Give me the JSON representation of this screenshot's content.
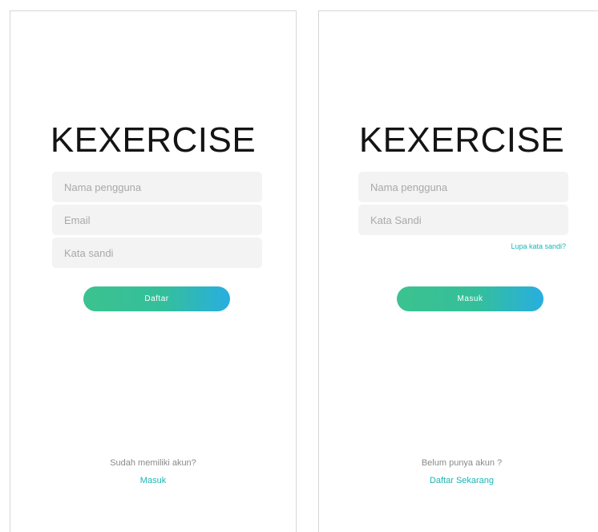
{
  "register_screen": {
    "logo": "KEXERCISE",
    "username_placeholder": "Nama pengguna",
    "email_placeholder": "Email",
    "password_placeholder": "Kata sandi",
    "submit_label": "Daftar",
    "footer_question": "Sudah memiliki akun?",
    "footer_link": "Masuk"
  },
  "login_screen": {
    "logo": "KEXERCISE",
    "username_placeholder": "Nama pengguna",
    "password_placeholder": "Kata Sandi",
    "forgot_label": "Lupa kata sandi?",
    "submit_label": "Masuk",
    "footer_question": "Belum punya akun ?",
    "footer_link": "Daftar Sekarang"
  },
  "colors": {
    "accent": "#1eb5b5",
    "button_gradient_start": "#3cc28f",
    "button_gradient_end": "#28aee0",
    "field_background": "#f3f3f3"
  }
}
